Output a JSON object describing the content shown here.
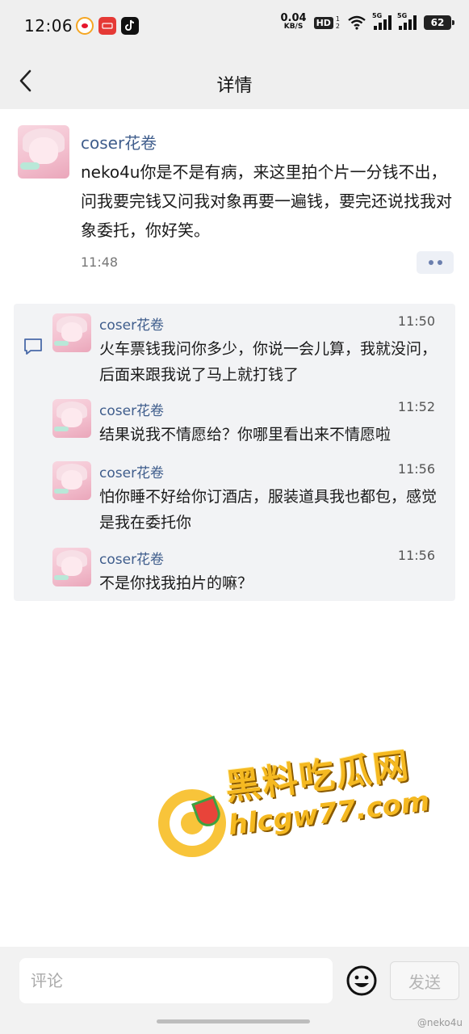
{
  "status_bar": {
    "time": "12:06",
    "net_speed_value": "0.04",
    "net_speed_unit": "KB/S",
    "hd_label": "HD",
    "hd_sub": "1\n2",
    "signal_tags": [
      "5G",
      "5G"
    ],
    "battery": "62",
    "app_icons": [
      "weibo-icon",
      "toutiao-icon",
      "tiktok-icon"
    ]
  },
  "nav": {
    "title": "详情",
    "back_icon": "chevron-left-icon"
  },
  "main_comment": {
    "name": "coser花卷",
    "text": "neko4u你是不是有病，来这里拍个片一分钱不出，问我要完钱又问我对象再要一遍钱，要完还说找我对象委托，你好笑。",
    "time": "11:48"
  },
  "replies": [
    {
      "name": "coser花卷",
      "time": "11:50",
      "text": "火车票钱我问你多少，你说一会儿算，我就没问，后面来跟我说了马上就打钱了"
    },
    {
      "name": "coser花卷",
      "time": "11:52",
      "text": "结果说我不情愿给？你哪里看出来不情愿啦"
    },
    {
      "name": "coser花卷",
      "time": "11:56",
      "text": "怕你睡不好给你订酒店，服装道具我也都包，感觉是我在委托你"
    },
    {
      "name": "coser花卷",
      "time": "11:56",
      "text": "不是你找我拍片的嘛？"
    }
  ],
  "watermark": {
    "title": "黑料吃瓜网",
    "domain": "hlcgw77.com"
  },
  "bottom_bar": {
    "comment_placeholder": "评论",
    "send_label": "发送",
    "emoji_icon": "smiley-icon"
  },
  "source_mark": "@neko4u",
  "colors": {
    "name_link": "#3f5d8c",
    "replies_bg": "#f2f3f5",
    "watermark_yellow": "#f5b921"
  }
}
